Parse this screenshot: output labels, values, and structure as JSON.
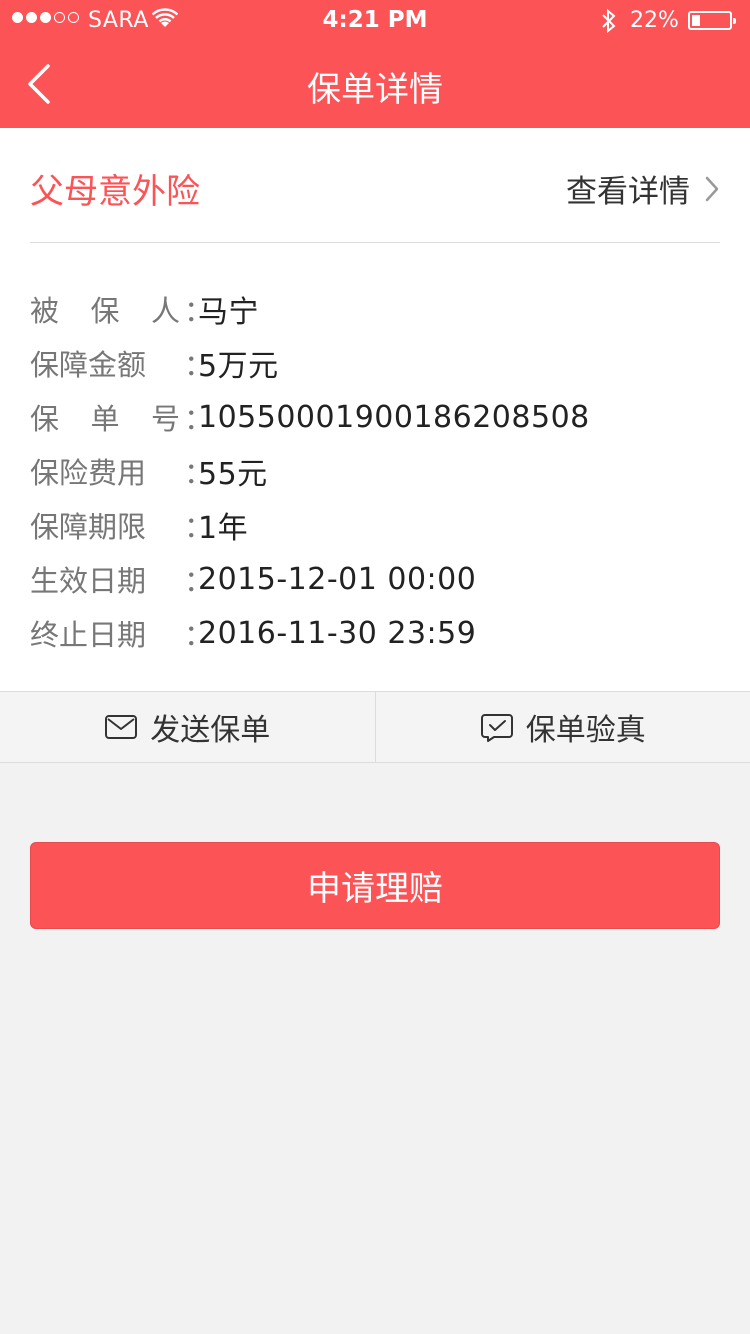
{
  "status_bar": {
    "carrier": "SARA",
    "time": "4:21 PM",
    "battery_percent": "22%",
    "battery_level": 0.22,
    "signal_strength": 3,
    "signal_max": 5
  },
  "navbar": {
    "title": "保单详情",
    "back_icon": "chevron-left-icon"
  },
  "policy": {
    "product_name": "父母意外险",
    "detail_link": "查看详情",
    "fields": [
      {
        "label": "被保人",
        "value": "马宁"
      },
      {
        "label": "保障金额",
        "value": "5万元"
      },
      {
        "label": "保单号",
        "value": "1055000190018620850​8"
      },
      {
        "label": "保险费用",
        "value": "55元"
      },
      {
        "label": "保障期限",
        "value": "1年"
      },
      {
        "label": "生效日期",
        "value": "2015-12-01 00:00"
      },
      {
        "label": "终止日期",
        "value": "2016-11-30 23:59"
      }
    ],
    "colon": "："
  },
  "actions": {
    "send_label": "发送保单",
    "verify_label": "保单验真"
  },
  "claim": {
    "label": "申请理赔"
  },
  "colors": {
    "brand": "#fc5357",
    "background": "#f2f2f2"
  }
}
